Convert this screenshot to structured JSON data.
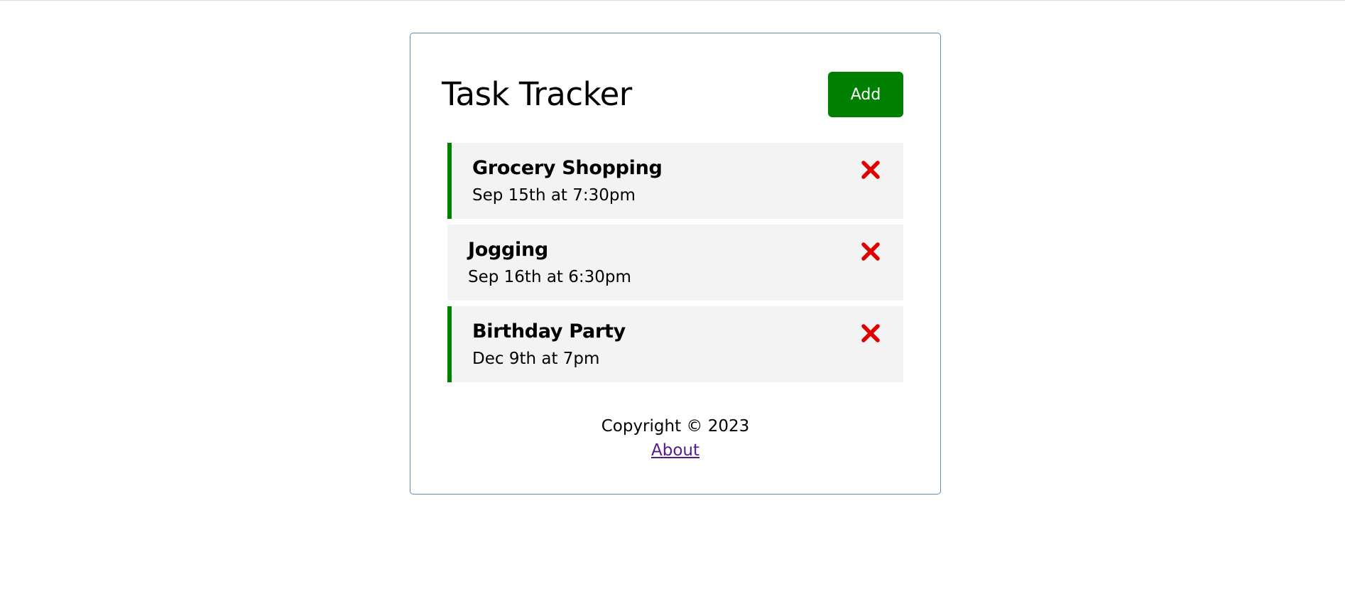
{
  "header": {
    "title": "Task Tracker",
    "add_label": "Add"
  },
  "tasks": [
    {
      "name": "Grocery Shopping",
      "date": "Sep 15th at 7:30pm",
      "reminder": true
    },
    {
      "name": "Jogging",
      "date": "Sep 16th at 6:30pm",
      "reminder": false
    },
    {
      "name": "Birthday Party",
      "date": "Dec 9th at 7pm",
      "reminder": true
    }
  ],
  "icons": {
    "delete": "close-icon"
  },
  "colors": {
    "accent": "#008000",
    "delete": "#e00000",
    "task_bg": "#f3f3f3",
    "border": "#5b8db8",
    "link": "#551a8b"
  },
  "footer": {
    "copyright": "Copyright © 2023",
    "about_label": "About"
  }
}
